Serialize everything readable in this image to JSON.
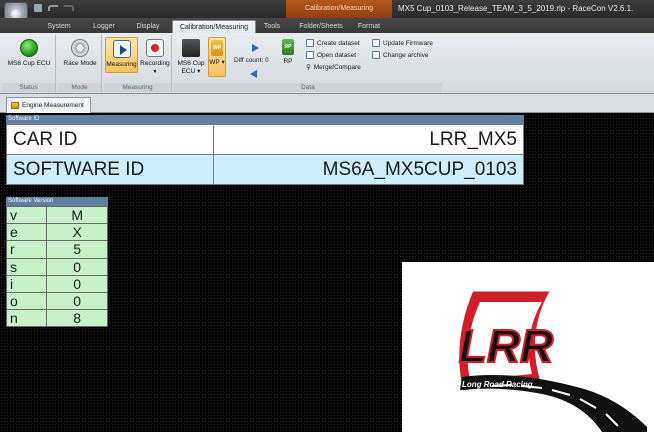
{
  "titlebar": {
    "context_tab_header": "Calibration/Measuring",
    "window_title": "MX5 Cup_0103_Release_TEAM_3_5_2019.rlp - RaceCon V2.6.1."
  },
  "tabs": [
    "System",
    "Logger",
    "Display",
    "Calibration/Measuring",
    "Tools",
    "Folder/Sheets",
    "Format"
  ],
  "ribbon": {
    "status": {
      "button": "MS6 Cup ECU",
      "group": "Status"
    },
    "mode": {
      "button": "Race Mode",
      "group": "Mode"
    },
    "measuring": {
      "btn_measuring": "Measuring",
      "btn_recording": "Recording",
      "group": "Measuring"
    },
    "data": {
      "btn_ecu": "MS6 Cup ECU ▾",
      "btn_wp": "WP ▾",
      "wp_icon": "WP",
      "diff_count": "Diff count: 0",
      "btn_rp": "RP",
      "rp_icon": "RP",
      "create_dataset": "Create dataset",
      "open_dataset": "Open dataset",
      "merge_compare": "Merge/Compare",
      "update_firmware": "Update Firmware",
      "change_archive": "Change archive",
      "group": "Data"
    }
  },
  "doc_tab": "Engine Measurement",
  "software_id": {
    "panel_title": "Software ID",
    "rows": [
      {
        "label": "CAR ID",
        "value": "LRR_MX5"
      },
      {
        "label": "SOFTWARE ID",
        "value": "MS6A_MX5CUP_0103"
      }
    ]
  },
  "software_version": {
    "panel_title": "Software Version",
    "rows": [
      {
        "label": "v",
        "value": "M"
      },
      {
        "label": "e",
        "value": "X"
      },
      {
        "label": "r",
        "value": "5"
      },
      {
        "label": "s",
        "value": "0"
      },
      {
        "label": "i",
        "value": "0"
      },
      {
        "label": "o",
        "value": "0"
      },
      {
        "label": "n",
        "value": "8"
      }
    ]
  },
  "logo": {
    "letters": "LRR",
    "tagline": "Long Road Racing"
  },
  "colors": {
    "title_bar": "#333333",
    "ribbon": "#dfe3e7",
    "context_tab": "#a64b18",
    "selected_button": "#f7c35d",
    "software_id_highlight": "#cfeefc",
    "version_cell": "#c7f2c9",
    "panel_title_bar": "#5f7fa3",
    "logo_red": "#d11f2a"
  }
}
